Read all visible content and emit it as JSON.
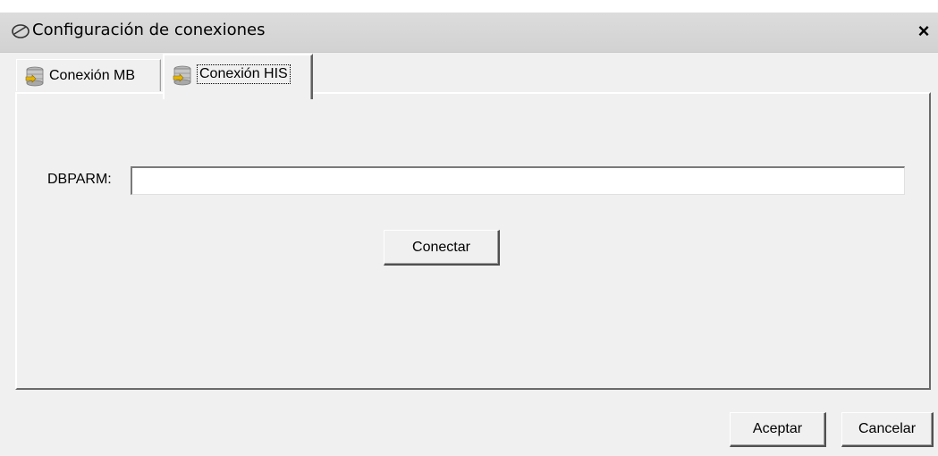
{
  "window": {
    "title": "Configuración de conexiones",
    "close_label": "×"
  },
  "tabs": [
    {
      "label": "Conexión MB",
      "icon": "database-icon",
      "selected": false
    },
    {
      "label": "Conexión HIS",
      "icon": "database-icon",
      "selected": true
    }
  ],
  "form": {
    "dbparm_label": "DBPARM:",
    "dbparm_value": "",
    "connect_label": "Conectar"
  },
  "footer": {
    "accept_label": "Aceptar",
    "cancel_label": "Cancelar"
  },
  "colors": {
    "window_bg": "#f0f0f0",
    "titlebar_bg": "#d6d6d6",
    "input_bg": "#ffffff"
  }
}
